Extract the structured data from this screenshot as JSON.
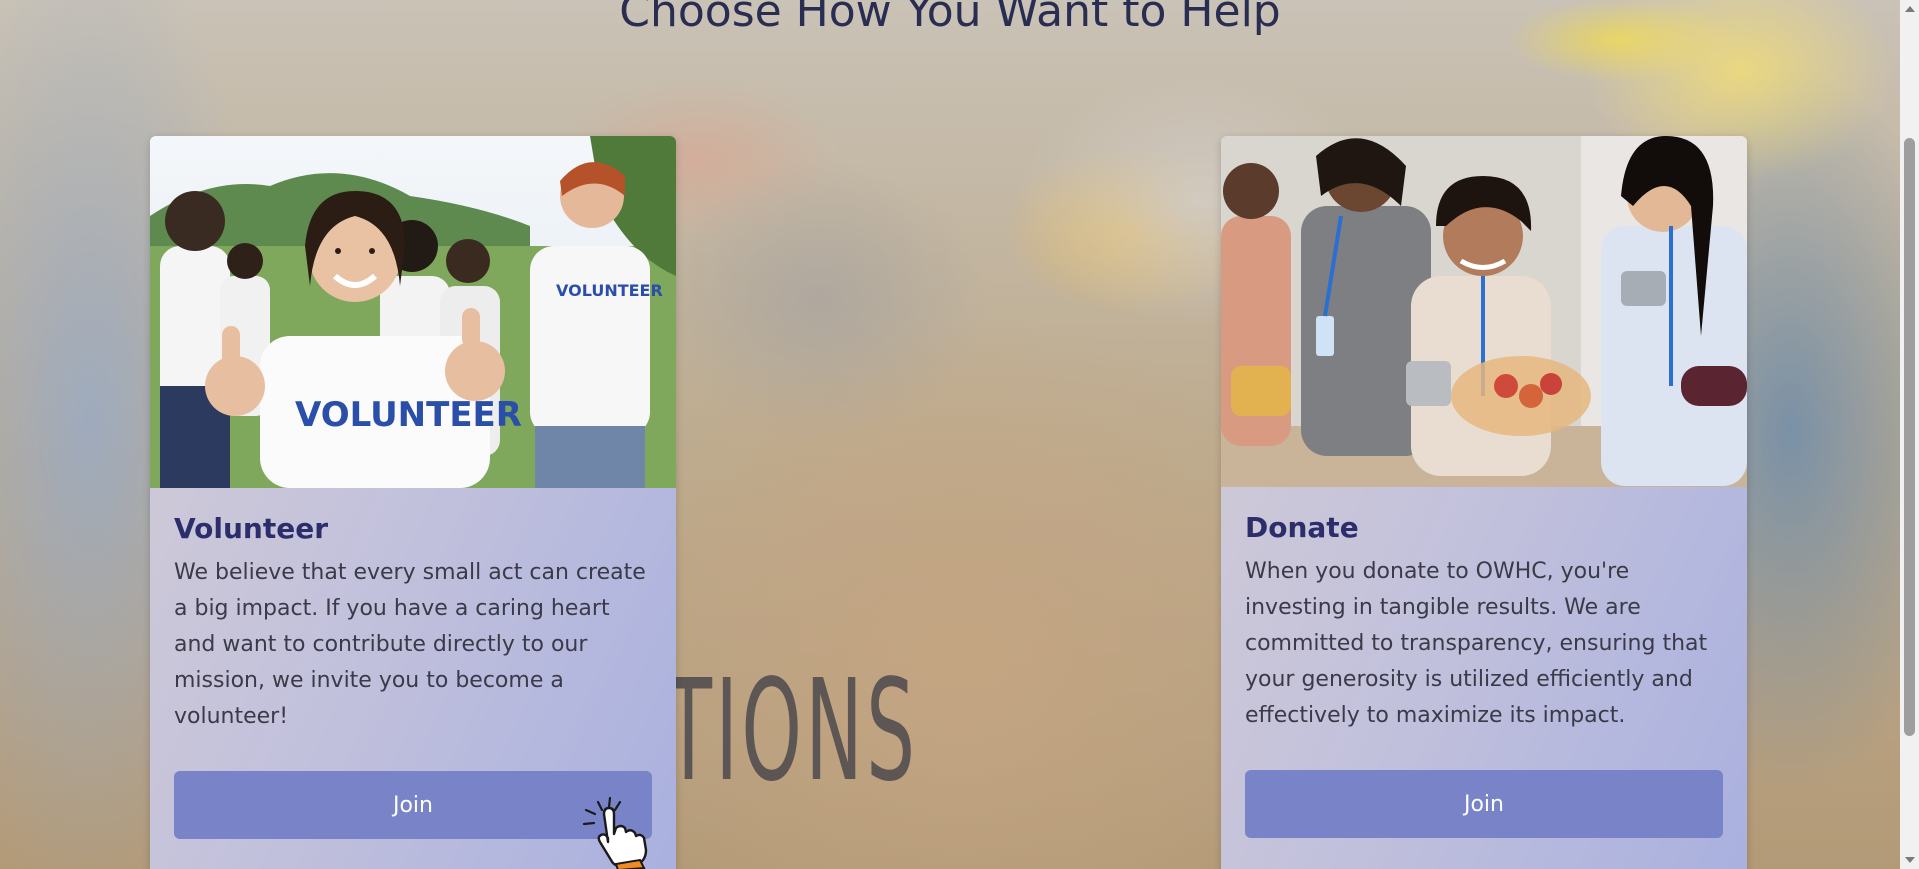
{
  "section": {
    "heading": "Choose How You Want to Help"
  },
  "background": {
    "box_lettering": "TIONS"
  },
  "cards": [
    {
      "title": "Volunteer",
      "text": "We believe that every small act can create a big impact. If you have a caring heart and want to contribute directly to our mission, we invite you to become a volunteer!",
      "button_label": "Join",
      "image_shirt_text": "VOLUNTEER"
    },
    {
      "title": "Donate",
      "text": "When you donate to OWHC, you're investing in tangible results. We are committed to transparency, ensuring that your generosity is utilized efficiently and effectively to maximize its impact.",
      "button_label": "Join"
    }
  ],
  "colors": {
    "heading": "#2a2d52",
    "card_title": "#2b2e6b",
    "button": "#7883c8",
    "button_text": "#ffffff"
  },
  "icons": {
    "cursor": "hand-pointer-icon"
  }
}
